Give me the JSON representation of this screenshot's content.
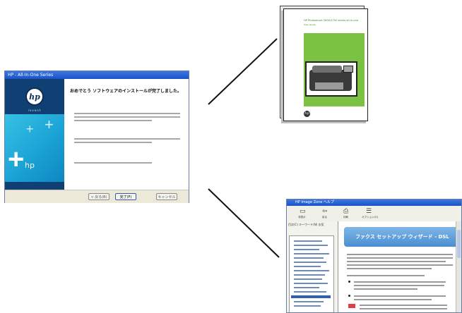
{
  "installer": {
    "title": "HP - All-In-One Series",
    "heading": "おめでとう ソフトウェアのインストールが完了しました。",
    "logo_text": "hp",
    "invent": "invent",
    "brand": "hp",
    "buttons": {
      "back": "< 戻る(B)",
      "finish": "完了(F)",
      "cancel": "キャンセル"
    }
  },
  "manual": {
    "title": "HP Photosmart 2600/2700 series all-in-one",
    "subtitle": "User Guide",
    "logo": "hp",
    "cover_color": "#7cc242"
  },
  "help": {
    "title": "HP Image Zone ヘルプ",
    "toolbar": [
      {
        "icon": "hide-icon",
        "label": "非表示"
      },
      {
        "icon": "back-icon",
        "label": "戻る"
      },
      {
        "icon": "print-icon",
        "label": "印刷"
      },
      {
        "icon": "options-icon",
        "label": "オプション(O)"
      }
    ],
    "tabs": "目次(C)  キーワード(N)  お気",
    "banner": "ファクス セットアップ ウィザード - DSL"
  },
  "colors": {
    "title_bar": "#1c52c8",
    "sidebar_dark": "#0f3f73",
    "sidebar_teal": "#1ba3d6",
    "banner_blue": "#4a8ed2"
  }
}
